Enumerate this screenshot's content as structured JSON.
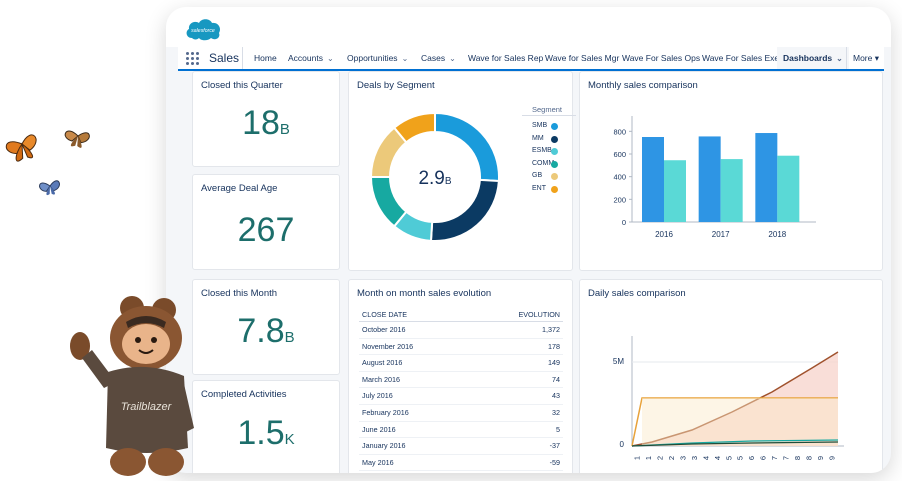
{
  "header": {
    "logo_text": "salesforce"
  },
  "nav": {
    "app_name": "Sales",
    "items": [
      {
        "label": "Home",
        "chevron": false
      },
      {
        "label": "Accounts",
        "chevron": true
      },
      {
        "label": "Opportunities",
        "chevron": true
      },
      {
        "label": "Cases",
        "chevron": true
      },
      {
        "label": "Wave for Sales Rep",
        "chevron": false
      },
      {
        "label": "Wave for Sales Mgr",
        "chevron": false
      },
      {
        "label": "Wave For Sales Ops",
        "chevron": false
      },
      {
        "label": "Wave For Sales Exec",
        "chevron": false
      },
      {
        "label": "Dashboards",
        "chevron": true,
        "active": true
      }
    ],
    "more_label": "More ▾"
  },
  "metrics": [
    {
      "title": "Closed this Quarter",
      "value": "18",
      "suffix": "B"
    },
    {
      "title": "Average Deal Age",
      "value": "267",
      "suffix": ""
    },
    {
      "title": "Closed this Month",
      "value": "7.8",
      "suffix": "B"
    },
    {
      "title": "Completed Activities",
      "value": "1.5",
      "suffix": "K"
    }
  ],
  "donut": {
    "title": "Deals by Segment",
    "center_value": "2.9",
    "center_suffix": "B",
    "legend_title": "Segment",
    "segments": [
      {
        "label": "SMB",
        "value": 26,
        "color": "#1a9bdb"
      },
      {
        "label": "MM",
        "value": 25,
        "color": "#0b3a63"
      },
      {
        "label": "ESMB",
        "value": 10,
        "color": "#4fcbd6"
      },
      {
        "label": "COMM",
        "value": 14,
        "color": "#17a9a1"
      },
      {
        "label": "GB",
        "value": 14,
        "color": "#ecc97a"
      },
      {
        "label": "ENT",
        "value": 11,
        "color": "#f0a21b"
      }
    ]
  },
  "chart_data": [
    {
      "type": "bar",
      "title": "Monthly sales comparison",
      "categories": [
        "2016",
        "2017",
        "2018"
      ],
      "series": [
        {
          "values": [
            750,
            755,
            785
          ],
          "color": "#2e95e4"
        },
        {
          "values": [
            545,
            555,
            585
          ],
          "color": "#5ad9d6"
        }
      ],
      "ylim": [
        0,
        900
      ],
      "yticks": [
        0,
        200,
        400,
        600,
        800
      ]
    },
    {
      "type": "area",
      "title": "Daily sales comparison",
      "ytick_labels": [
        "5M",
        "0"
      ],
      "xtick_labels": [
        "1",
        "1",
        "2",
        "2",
        "3",
        "3",
        "4",
        "4",
        "5",
        "5",
        "6",
        "6",
        "7",
        "7",
        "8",
        "8",
        "9",
        "9"
      ]
    }
  ],
  "evolution": {
    "title": "Month on month sales evolution",
    "columns": [
      "CLOSE DATE",
      "EVOLUTION"
    ],
    "rows": [
      [
        "October 2016",
        "1,372"
      ],
      [
        "November 2016",
        "178"
      ],
      [
        "August 2016",
        "149"
      ],
      [
        "March 2016",
        "74"
      ],
      [
        "July 2016",
        "43"
      ],
      [
        "February 2016",
        "32"
      ],
      [
        "June 2016",
        "5"
      ],
      [
        "January 2016",
        "-37"
      ],
      [
        "May 2016",
        "-59"
      ]
    ]
  }
}
